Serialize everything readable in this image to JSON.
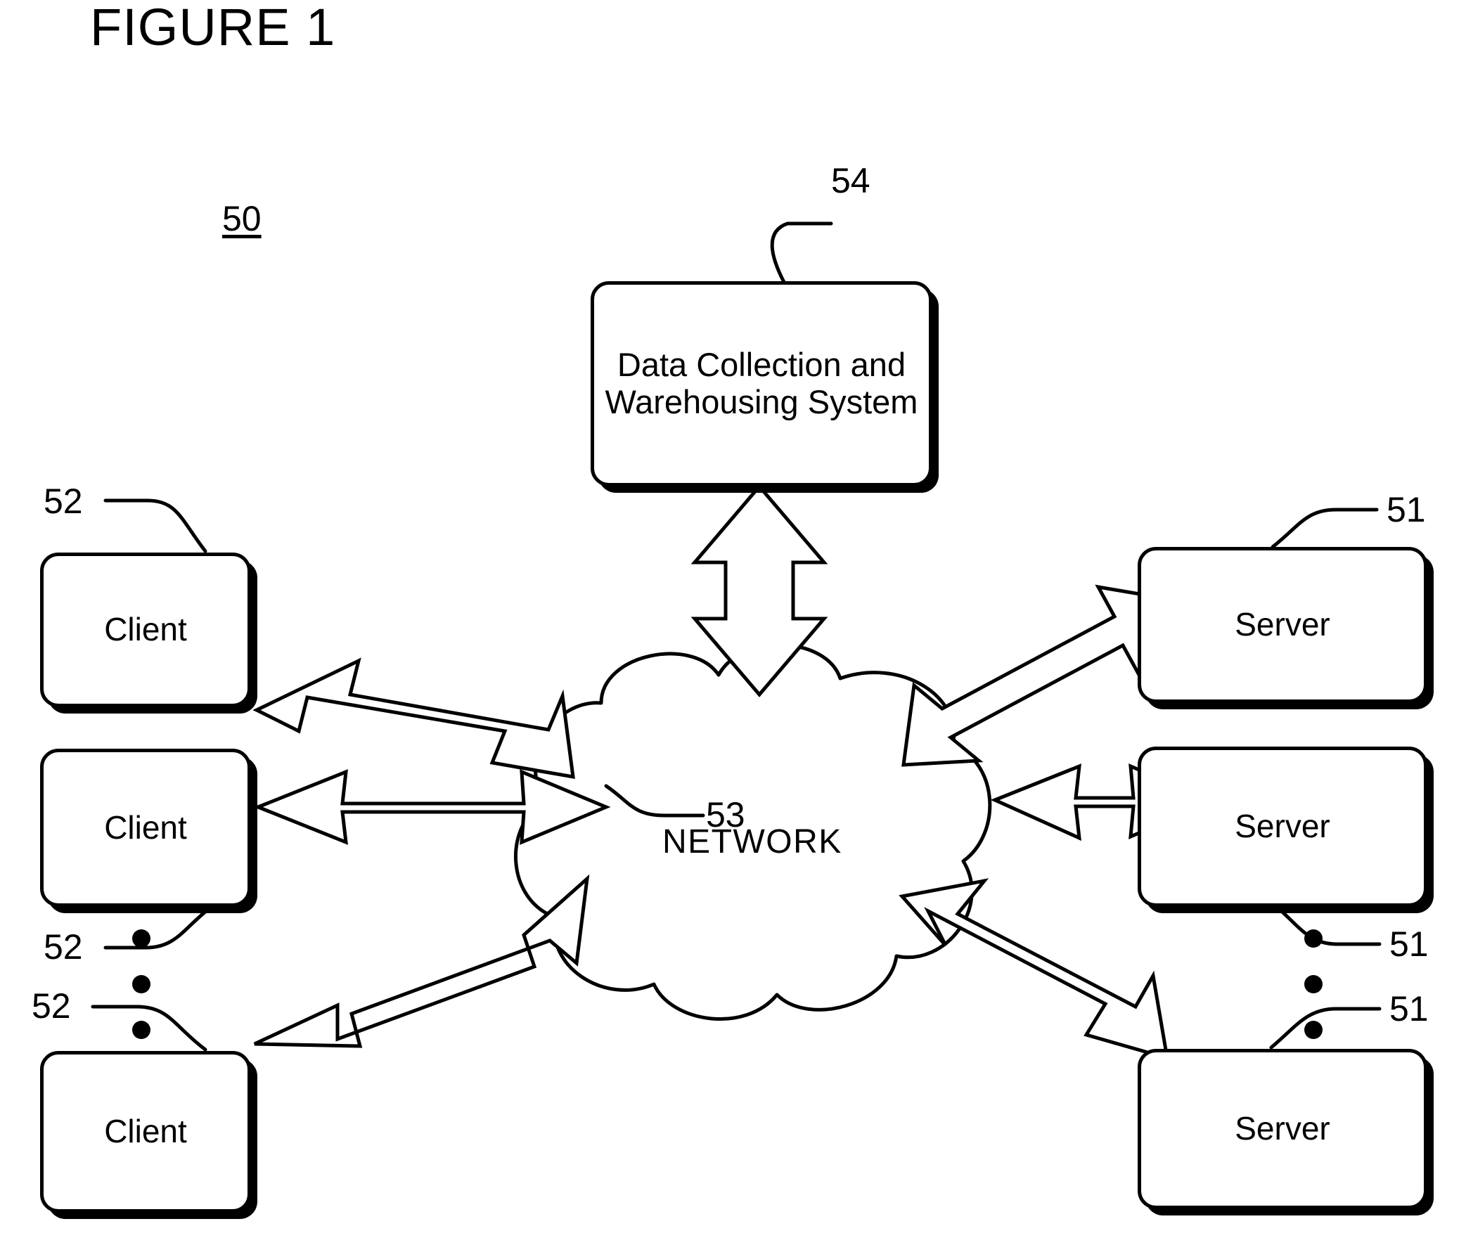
{
  "figure": {
    "title": "FIGURE 1",
    "system_ref": "50"
  },
  "nodes": {
    "warehouse": {
      "label": "Data Collection and Warehousing System",
      "ref": "54"
    },
    "network": {
      "label": "NETWORK"
    },
    "clients": [
      {
        "label": "Client",
        "ref": "52"
      },
      {
        "label": "Client",
        "ref": "52"
      },
      {
        "label": "Client",
        "ref": "52"
      }
    ],
    "servers": [
      {
        "label": "Server",
        "ref": "51"
      },
      {
        "label": "Server",
        "ref": "51"
      },
      {
        "label": "Server",
        "ref": "51"
      }
    ]
  },
  "connections": {
    "network_link_ref": "53"
  },
  "ellipsis": {
    "left_dots": 3,
    "right_dots": 3
  },
  "colors": {
    "ink": "#000000",
    "paper": "#ffffff"
  }
}
